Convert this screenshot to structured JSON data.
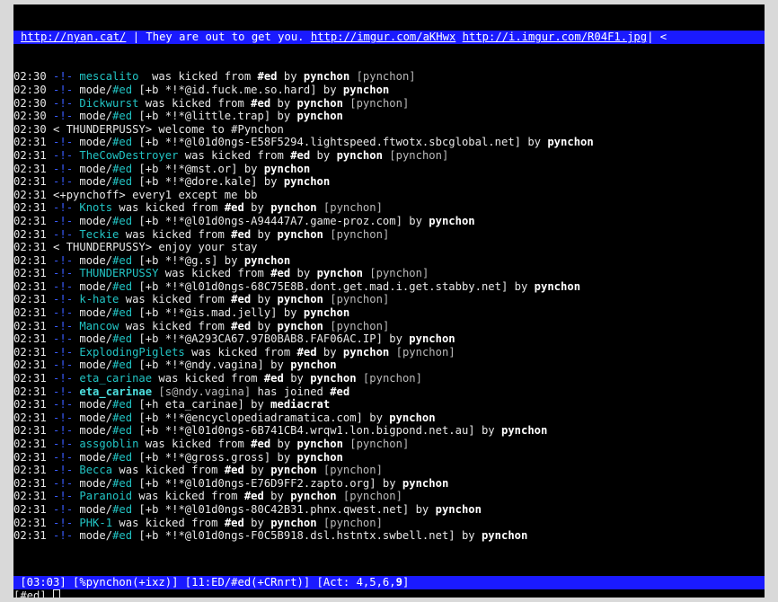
{
  "topic": {
    "link1": "http://nyan.cat/",
    "text": " | They are out to get you. ",
    "link2": "http://imgur.com/aKHwx",
    "link3": "http://i.imgur.com/R04F1.jpg",
    "tail": "| <"
  },
  "lines": [
    {
      "ts": "02:30",
      "sep": " -!- ",
      "parts": [
        [
          "teal",
          "mescalito"
        ],
        [
          "",
          "  was kicked from "
        ],
        [
          "b",
          "#ed"
        ],
        [
          "",
          " by "
        ],
        [
          "b",
          "pynchon"
        ],
        [
          "dim",
          " [pynchon]"
        ]
      ]
    },
    {
      "ts": "02:30",
      "sep": " -!- ",
      "parts": [
        [
          "",
          "mode/"
        ],
        [
          "teal",
          "#ed"
        ],
        [
          "",
          " [+b *!*@id.fuck.me.so.hard] by "
        ],
        [
          "b",
          "pynchon"
        ]
      ]
    },
    {
      "ts": "02:30",
      "sep": " -!- ",
      "parts": [
        [
          "teal",
          "Dickwurst"
        ],
        [
          "",
          " was kicked from "
        ],
        [
          "b",
          "#ed"
        ],
        [
          "",
          " by "
        ],
        [
          "b",
          "pynchon"
        ],
        [
          "dim",
          " [pynchon]"
        ]
      ]
    },
    {
      "ts": "02:30",
      "sep": " -!- ",
      "parts": [
        [
          "",
          "mode/"
        ],
        [
          "teal",
          "#ed"
        ],
        [
          "",
          " [+b *!*@little.trap] by "
        ],
        [
          "b",
          "pynchon"
        ]
      ]
    },
    {
      "ts": "02:30",
      "sep": " ",
      "parts": [
        [
          "",
          "< THUNDERPUSSY> welcome to #Pynchon"
        ]
      ]
    },
    {
      "ts": "02:31",
      "sep": " -!- ",
      "parts": [
        [
          "",
          "mode/"
        ],
        [
          "teal",
          "#ed"
        ],
        [
          "",
          " [+b *!*@l01d0ngs-E58F5294.lightspeed.ftwotx.sbcglobal.net] by "
        ],
        [
          "b",
          "pynchon"
        ]
      ]
    },
    {
      "ts": "02:31",
      "sep": " -!- ",
      "parts": [
        [
          "teal",
          "TheCowDestroyer"
        ],
        [
          "",
          " was kicked from "
        ],
        [
          "b",
          "#ed"
        ],
        [
          "",
          " by "
        ],
        [
          "b",
          "pynchon"
        ],
        [
          "dim",
          " [pynchon]"
        ]
      ]
    },
    {
      "ts": "02:31",
      "sep": " -!- ",
      "parts": [
        [
          "",
          "mode/"
        ],
        [
          "teal",
          "#ed"
        ],
        [
          "",
          " [+b *!*@mst.or] by "
        ],
        [
          "b",
          "pynchon"
        ]
      ]
    },
    {
      "ts": "02:31",
      "sep": " -!- ",
      "parts": [
        [
          "",
          "mode/"
        ],
        [
          "teal",
          "#ed"
        ],
        [
          "",
          " [+b *!*@dore.kale] by "
        ],
        [
          "b",
          "pynchon"
        ]
      ]
    },
    {
      "ts": "02:31",
      "sep": " ",
      "parts": [
        [
          "",
          "<+pynchoff> every1 except me bb"
        ]
      ]
    },
    {
      "ts": "02:31",
      "sep": " -!- ",
      "parts": [
        [
          "teal",
          "Knots"
        ],
        [
          "",
          " was kicked from "
        ],
        [
          "b",
          "#ed"
        ],
        [
          "",
          " by "
        ],
        [
          "b",
          "pynchon"
        ],
        [
          "dim",
          " [pynchon]"
        ]
      ]
    },
    {
      "ts": "02:31",
      "sep": " -!- ",
      "parts": [
        [
          "",
          "mode/"
        ],
        [
          "teal",
          "#ed"
        ],
        [
          "",
          " [+b *!*@l01d0ngs-A94447A7.game-proz.com] by "
        ],
        [
          "b",
          "pynchon"
        ]
      ]
    },
    {
      "ts": "02:31",
      "sep": " -!- ",
      "parts": [
        [
          "teal",
          "Teckie"
        ],
        [
          "",
          " was kicked from "
        ],
        [
          "b",
          "#ed"
        ],
        [
          "",
          " by "
        ],
        [
          "b",
          "pynchon"
        ],
        [
          "dim",
          " [pynchon]"
        ]
      ]
    },
    {
      "ts": "02:31",
      "sep": " ",
      "parts": [
        [
          "",
          "< THUNDERPUSSY> enjoy your stay"
        ]
      ]
    },
    {
      "ts": "02:31",
      "sep": " -!- ",
      "parts": [
        [
          "",
          "mode/"
        ],
        [
          "teal",
          "#ed"
        ],
        [
          "",
          " [+b *!*@g.s] by "
        ],
        [
          "b",
          "pynchon"
        ]
      ]
    },
    {
      "ts": "02:31",
      "sep": " -!- ",
      "parts": [
        [
          "teal",
          "THUNDERPUSSY"
        ],
        [
          "",
          " was kicked from "
        ],
        [
          "b",
          "#ed"
        ],
        [
          "",
          " by "
        ],
        [
          "b",
          "pynchon"
        ],
        [
          "dim",
          " [pynchon]"
        ]
      ]
    },
    {
      "ts": "02:31",
      "sep": " -!- ",
      "parts": [
        [
          "",
          "mode/"
        ],
        [
          "teal",
          "#ed"
        ],
        [
          "",
          " [+b *!*@l01d0ngs-68C75E8B.dont.get.mad.i.get.stabby.net] by "
        ],
        [
          "b",
          "pynchon"
        ]
      ]
    },
    {
      "ts": "02:31",
      "sep": " -!- ",
      "parts": [
        [
          "teal",
          "k-hate"
        ],
        [
          "",
          " was kicked from "
        ],
        [
          "b",
          "#ed"
        ],
        [
          "",
          " by "
        ],
        [
          "b",
          "pynchon"
        ],
        [
          "dim",
          " [pynchon]"
        ]
      ]
    },
    {
      "ts": "02:31",
      "sep": " -!- ",
      "parts": [
        [
          "",
          "mode/"
        ],
        [
          "teal",
          "#ed"
        ],
        [
          "",
          " [+b *!*@is.mad.jelly] by "
        ],
        [
          "b",
          "pynchon"
        ]
      ]
    },
    {
      "ts": "02:31",
      "sep": " -!- ",
      "parts": [
        [
          "teal",
          "Mancow"
        ],
        [
          "",
          " was kicked from "
        ],
        [
          "b",
          "#ed"
        ],
        [
          "",
          " by "
        ],
        [
          "b",
          "pynchon"
        ],
        [
          "dim",
          " [pynchon]"
        ]
      ]
    },
    {
      "ts": "02:31",
      "sep": " -!- ",
      "parts": [
        [
          "",
          "mode/"
        ],
        [
          "teal",
          "#ed"
        ],
        [
          "",
          " [+b *!*@A293CA67.97B0BAB8.FAF06AC.IP] by "
        ],
        [
          "b",
          "pynchon"
        ]
      ]
    },
    {
      "ts": "02:31",
      "sep": " -!- ",
      "parts": [
        [
          "teal",
          "ExplodingPiglets"
        ],
        [
          "",
          " was kicked from "
        ],
        [
          "b",
          "#ed"
        ],
        [
          "",
          " by "
        ],
        [
          "b",
          "pynchon"
        ],
        [
          "dim",
          " [pynchon]"
        ]
      ]
    },
    {
      "ts": "02:31",
      "sep": " -!- ",
      "parts": [
        [
          "",
          "mode/"
        ],
        [
          "teal",
          "#ed"
        ],
        [
          "",
          " [+b *!*@ndy.vagina] by "
        ],
        [
          "b",
          "pynchon"
        ]
      ]
    },
    {
      "ts": "02:31",
      "sep": " -!- ",
      "parts": [
        [
          "teal",
          "eta_carinae"
        ],
        [
          "",
          " was kicked from "
        ],
        [
          "b",
          "#ed"
        ],
        [
          "",
          " by "
        ],
        [
          "b",
          "pynchon"
        ],
        [
          "dim",
          " [pynchon]"
        ]
      ]
    },
    {
      "ts": "02:31",
      "sep": " -!- ",
      "parts": [
        [
          "tealb",
          "eta_carinae"
        ],
        [
          "dim",
          " [s@ndy.vagina]"
        ],
        [
          "",
          " has joined "
        ],
        [
          "b",
          "#ed"
        ]
      ]
    },
    {
      "ts": "02:31",
      "sep": " -!- ",
      "parts": [
        [
          "",
          "mode/"
        ],
        [
          "teal",
          "#ed"
        ],
        [
          "",
          " [+h eta_carinae] by "
        ],
        [
          "b",
          "mediacrat"
        ]
      ]
    },
    {
      "ts": "02:31",
      "sep": " -!- ",
      "parts": [
        [
          "",
          "mode/"
        ],
        [
          "teal",
          "#ed"
        ],
        [
          "",
          " [+b *!*@encyclopediadramatica.com] by "
        ],
        [
          "b",
          "pynchon"
        ]
      ]
    },
    {
      "ts": "02:31",
      "sep": " -!- ",
      "parts": [
        [
          "",
          "mode/"
        ],
        [
          "teal",
          "#ed"
        ],
        [
          "",
          " [+b *!*@l01d0ngs-6B741CB4.wrqw1.lon.bigpond.net.au] by "
        ],
        [
          "b",
          "pynchon"
        ]
      ]
    },
    {
      "ts": "02:31",
      "sep": " -!- ",
      "parts": [
        [
          "teal",
          "assgoblin"
        ],
        [
          "",
          " was kicked from "
        ],
        [
          "b",
          "#ed"
        ],
        [
          "",
          " by "
        ],
        [
          "b",
          "pynchon"
        ],
        [
          "dim",
          " [pynchon]"
        ]
      ]
    },
    {
      "ts": "02:31",
      "sep": " -!- ",
      "parts": [
        [
          "",
          "mode/"
        ],
        [
          "teal",
          "#ed"
        ],
        [
          "",
          " [+b *!*@gross.gross] by "
        ],
        [
          "b",
          "pynchon"
        ]
      ]
    },
    {
      "ts": "02:31",
      "sep": " -!- ",
      "parts": [
        [
          "teal",
          "Becca"
        ],
        [
          "",
          " was kicked from "
        ],
        [
          "b",
          "#ed"
        ],
        [
          "",
          " by "
        ],
        [
          "b",
          "pynchon"
        ],
        [
          "dim",
          " [pynchon]"
        ]
      ]
    },
    {
      "ts": "02:31",
      "sep": " -!- ",
      "parts": [
        [
          "",
          "mode/"
        ],
        [
          "teal",
          "#ed"
        ],
        [
          "",
          " [+b *!*@l01d0ngs-E76D9FF2.zapto.org] by "
        ],
        [
          "b",
          "pynchon"
        ]
      ]
    },
    {
      "ts": "02:31",
      "sep": " -!- ",
      "parts": [
        [
          "teal",
          "Paranoid"
        ],
        [
          "",
          " was kicked from "
        ],
        [
          "b",
          "#ed"
        ],
        [
          "",
          " by "
        ],
        [
          "b",
          "pynchon"
        ],
        [
          "dim",
          " [pynchon]"
        ]
      ]
    },
    {
      "ts": "02:31",
      "sep": " -!- ",
      "parts": [
        [
          "",
          "mode/"
        ],
        [
          "teal",
          "#ed"
        ],
        [
          "",
          " [+b *!*@l01d0ngs-80C42B31.phnx.qwest.net] by "
        ],
        [
          "b",
          "pynchon"
        ]
      ]
    },
    {
      "ts": "02:31",
      "sep": " -!- ",
      "parts": [
        [
          "teal",
          "PHK-1"
        ],
        [
          "",
          " was kicked from "
        ],
        [
          "b",
          "#ed"
        ],
        [
          "",
          " by "
        ],
        [
          "b",
          "pynchon"
        ],
        [
          "dim",
          " [pynchon]"
        ]
      ]
    },
    {
      "ts": "02:31",
      "sep": " -!- ",
      "parts": [
        [
          "",
          "mode/"
        ],
        [
          "teal",
          "#ed"
        ],
        [
          "",
          " [+b *!*@l01d0ngs-F0C5B918.dsl.hstntx.swbell.net] by "
        ],
        [
          "b",
          "pynchon"
        ]
      ]
    }
  ],
  "status": {
    "time": " [03:03]",
    "nick": " [%pynchon(+ixz)]",
    "window": " [11:ED/#ed(+CRnrt)]",
    "act_label": " [Act: ",
    "act_list": "4,5,6,",
    "act_bold": "9",
    "act_close": "]"
  },
  "input": {
    "prompt": "[#ed] "
  }
}
